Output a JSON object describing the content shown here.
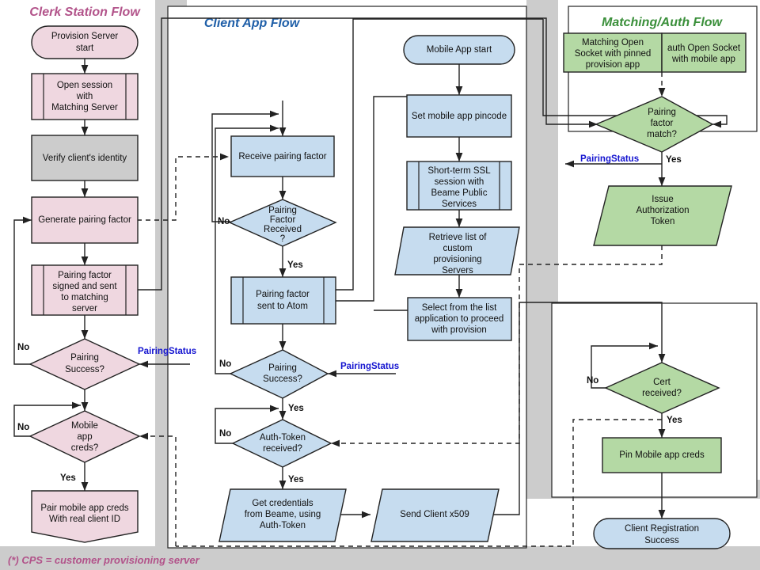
{
  "diagram": {
    "title_footnote": "(*) CPS = customer provisioning server",
    "colors": {
      "pink_fill": "#efd7e0",
      "blue_fill": "#c6dcef",
      "green_fill": "#b4d9a4",
      "gray_fill": "#cccccc",
      "band_gray": "#cccccc",
      "status_blue": "#1414d0",
      "title_pink": "#b2538a",
      "title_blue": "#1f5fa8",
      "title_green": "#3a8f3a"
    }
  },
  "lanes": [
    {
      "id": "clerk",
      "label": "Clerk Station Flow"
    },
    {
      "id": "client",
      "label": "Client App Flow"
    },
    {
      "id": "matching",
      "label": "Matching/Auth Flow"
    }
  ],
  "clerk_flow": {
    "nodes": [
      {
        "id": "provision-server-start",
        "shape": "terminator",
        "label": [
          "Provision Server",
          "start"
        ]
      },
      {
        "id": "open-session-matching-server",
        "shape": "predefined-process",
        "label": [
          "Open session",
          "with",
          "Matching Server"
        ]
      },
      {
        "id": "verify-client-identity",
        "shape": "process-gray",
        "label": [
          "Verify client's identity"
        ]
      },
      {
        "id": "generate-pairing-factor",
        "shape": "process",
        "label": [
          "Generate pairing factor"
        ]
      },
      {
        "id": "pairing-factor-signed-sent",
        "shape": "predefined-process",
        "label": [
          "Pairing factor",
          "signed and  sent",
          "to matching",
          "server"
        ]
      },
      {
        "id": "pairing-success-decision",
        "shape": "decision",
        "label": [
          "Pairing",
          "Success?"
        ]
      },
      {
        "id": "mobile-app-creds-decision",
        "shape": "decision",
        "label": [
          "Mobile",
          "app",
          "creds?"
        ]
      },
      {
        "id": "pair-mobile-app-creds",
        "shape": "manual-operation",
        "label": [
          "Pair mobile app creds",
          "With real client ID"
        ]
      }
    ],
    "edge_labels": [
      {
        "id": "clerk-pairing-no",
        "text": "No"
      },
      {
        "id": "clerk-creds-no",
        "text": "No"
      },
      {
        "id": "clerk-creds-yes",
        "text": "Yes"
      },
      {
        "id": "clerk-pairing-status",
        "text": "PairingStatus"
      }
    ]
  },
  "client_flow": {
    "nodes": [
      {
        "id": "receive-pairing-factor",
        "shape": "process",
        "label": [
          "Receive pairing factor"
        ]
      },
      {
        "id": "pairing-factor-received-decision",
        "shape": "decision",
        "label": [
          "Pairing",
          "Factor",
          "Received",
          "?"
        ]
      },
      {
        "id": "pairing-factor-sent-to-atom",
        "shape": "predefined-process",
        "label": [
          "Pairing factor",
          "sent to Atom"
        ]
      },
      {
        "id": "client-pairing-success-decision",
        "shape": "decision",
        "label": [
          "Pairing",
          "Success?"
        ]
      },
      {
        "id": "auth-token-received-decision",
        "shape": "decision",
        "label": [
          "Auth-Token",
          "received?"
        ]
      },
      {
        "id": "get-credentials-from-beame",
        "shape": "parallelogram",
        "label": [
          "Get credentials",
          "from Beame, using",
          "Auth-Token"
        ]
      },
      {
        "id": "send-client-x509",
        "shape": "parallelogram",
        "label": [
          "Send Client x509"
        ]
      },
      {
        "id": "mobile-app-start",
        "shape": "terminator",
        "label": [
          "Mobile App start"
        ]
      },
      {
        "id": "set-mobile-app-pincode",
        "shape": "process",
        "label": [
          "Set mobile app pincode"
        ]
      },
      {
        "id": "short-term-ssl-session",
        "shape": "predefined-process",
        "label": [
          "Short-term SSL",
          "session with",
          "Beame Public",
          "Services"
        ]
      },
      {
        "id": "retrieve-list-custom-servers",
        "shape": "parallelogram",
        "label": [
          "Retrieve list of",
          "custom",
          "provisioning",
          "Servers"
        ]
      },
      {
        "id": "select-from-list-application",
        "shape": "process",
        "label": [
          "Select from the list",
          "application to proceed",
          "with provision"
        ]
      }
    ],
    "edge_labels": [
      {
        "id": "client-factor-no",
        "text": "No"
      },
      {
        "id": "client-factor-yes",
        "text": "Yes"
      },
      {
        "id": "client-pairing-no",
        "text": "No"
      },
      {
        "id": "client-pairing-yes",
        "text": "Yes"
      },
      {
        "id": "client-auth-no",
        "text": "No"
      },
      {
        "id": "client-auth-yes",
        "text": "Yes"
      },
      {
        "id": "client-pairing-status",
        "text": "PairingStatus"
      }
    ]
  },
  "matching_flow": {
    "nodes": [
      {
        "id": "matching-open-socket",
        "shape": "process",
        "label": [
          "Matching Open",
          "Socket with pinned",
          "provision app"
        ]
      },
      {
        "id": "auth-open-socket",
        "shape": "process",
        "label": [
          "auth Open Socket",
          "with mobile app"
        ]
      },
      {
        "id": "pairing-factor-match-decision",
        "shape": "decision",
        "label": [
          "Pairing",
          "factor",
          "match?"
        ]
      },
      {
        "id": "issue-authorization-token",
        "shape": "parallelogram",
        "label": [
          "Issue",
          "Authorization",
          "Token"
        ]
      },
      {
        "id": "cert-received-decision",
        "shape": "decision",
        "label": [
          "Cert",
          "received?"
        ]
      },
      {
        "id": "pin-mobile-app-creds",
        "shape": "process",
        "label": [
          "Pin Mobile app creds"
        ]
      },
      {
        "id": "client-registration-success",
        "shape": "terminator",
        "label": [
          "Client Registration",
          "Success"
        ]
      }
    ],
    "edge_labels": [
      {
        "id": "matching-match-yes",
        "text": "Yes"
      },
      {
        "id": "matching-pairing-status",
        "text": "PairingStatus"
      },
      {
        "id": "matching-cert-no",
        "text": "No"
      },
      {
        "id": "matching-cert-yes",
        "text": "Yes"
      }
    ]
  }
}
